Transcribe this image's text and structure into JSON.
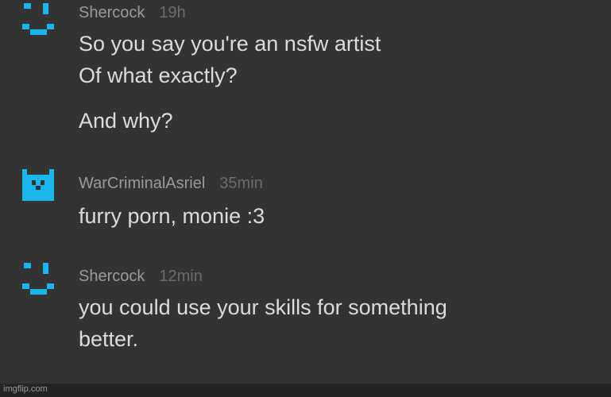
{
  "colors": {
    "background": "#333333",
    "username": "#9b9b9b",
    "timestamp": "#6c6c6c",
    "text": "#dcdcdc",
    "avatar_accent": "#18b6ea"
  },
  "comments": [
    {
      "username": "Shercock",
      "time": "19h",
      "avatar_icon": "pixel-smiley-icon",
      "lines": [
        "So you say you're an nsfw artist",
        "Of what exactly?",
        "And why?"
      ]
    },
    {
      "username": "WarCriminalAsriel",
      "time": "35min",
      "avatar_icon": "pixel-cat-face-icon",
      "lines": [
        "furry porn, monie :3"
      ]
    },
    {
      "username": "Shercock",
      "time": "12min",
      "avatar_icon": "pixel-smiley-icon",
      "lines": [
        "you could use your skills for something",
        "better."
      ]
    }
  ],
  "watermark": "imgflip.com"
}
